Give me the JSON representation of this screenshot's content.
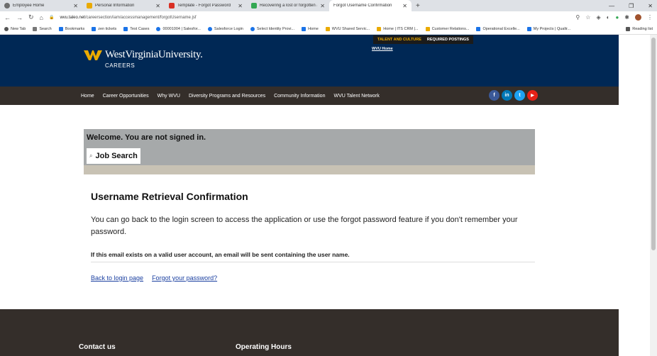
{
  "browser": {
    "tabs": [
      {
        "label": "Employee Home",
        "color": "#6d6d6d"
      },
      {
        "label": "Personal Information",
        "color": "#eaaa00"
      },
      {
        "label": "Template - Forgot Password",
        "color": "#d93025"
      },
      {
        "label": "Recovering a lost or forgotten ac",
        "color": "#34a853"
      },
      {
        "label": "Forgot Username Confirmation",
        "color": "#999999",
        "active": true
      }
    ],
    "url_host": "wvu.taleo.net",
    "url_path": "/careersection/iam/accessmanagement/forgotUsername.jsf",
    "bookmarks": [
      {
        "label": "New Tab",
        "color": "#555"
      },
      {
        "label": "Search",
        "color": "#555"
      },
      {
        "label": "Bookmarks",
        "color": "#1a73e8"
      },
      {
        "label": "zen tickets",
        "color": "#1a73e8"
      },
      {
        "label": "Test Cases",
        "color": "#1a73e8"
      },
      {
        "label": "00001004 | Salesfor...",
        "color": "#1a73e8"
      },
      {
        "label": "Salesforce Login",
        "color": "#1a73e8"
      },
      {
        "label": "Select Identity Provi...",
        "color": "#1a73e8"
      },
      {
        "label": "Home",
        "color": "#1a73e8"
      },
      {
        "label": "WVU Shared Servic...",
        "color": "#eaaa00"
      },
      {
        "label": "Home | ITS CRM |...",
        "color": "#eaaa00"
      },
      {
        "label": "Customer Relations...",
        "color": "#eaaa00"
      },
      {
        "label": "Operational Excelle...",
        "color": "#1a73e8"
      },
      {
        "label": "My Projects | Qualtr...",
        "color": "#1a73e8"
      },
      {
        "label": "Reading list",
        "color": "#555"
      }
    ]
  },
  "header": {
    "logo_text": "WestVirginiaUniversity.",
    "logo_sub": "CAREERS",
    "top_links": [
      "TALENT AND CULTURE",
      "REQUIRED POSTINGS"
    ],
    "wvu_home": "WVU Home",
    "brand_blue": "#002855",
    "brand_gold": "#eaaa00"
  },
  "nav": {
    "items": [
      "Home",
      "Career Opportunities",
      "Why WVU",
      "Diversity Programs and Resources",
      "Community Information",
      "WVU Talent Network"
    ],
    "socials": [
      {
        "label": "f",
        "color": "#3b5998",
        "icon": "facebook-icon"
      },
      {
        "label": "in",
        "color": "#0077b5",
        "icon": "linkedin-icon"
      },
      {
        "label": "t",
        "color": "#1da1f2",
        "icon": "twitter-icon"
      },
      {
        "label": "▶",
        "color": "#e62117",
        "icon": "youtube-icon"
      }
    ]
  },
  "welcome": {
    "text": "Welcome. You are not signed in.",
    "job_search": "Job Search"
  },
  "main": {
    "title": "Username Retrieval Confirmation",
    "body": "You can go back to the login screen to access the application or use the forgot password feature if you don't remember your password.",
    "notice": "If this email exists on a valid user account, an email will be sent containing the user name.",
    "back_link": "Back to login page",
    "forgot_link": "Forgot your password?"
  },
  "footer": {
    "contact": "Contact us",
    "hours": "Operating Hours"
  }
}
